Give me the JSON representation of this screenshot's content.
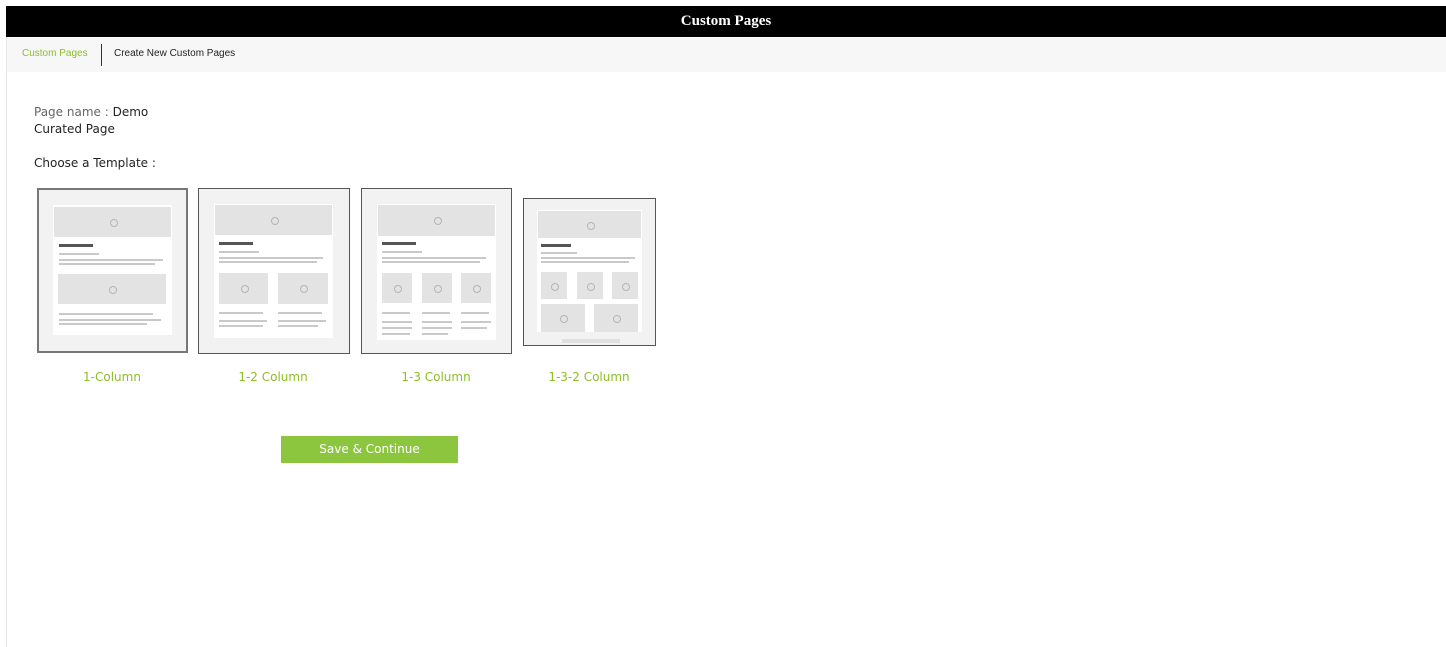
{
  "window": {
    "title": "Custom Pages"
  },
  "tabs": {
    "current": "Custom Pages",
    "create": "Create New Custom Pages"
  },
  "page": {
    "name_label": "Page name :",
    "name_value_line1": "Demo",
    "name_value_line2": "Curated Page",
    "choose_label": "Choose a Template :"
  },
  "templates": [
    {
      "label": "1-Column"
    },
    {
      "label": "1-2 Column"
    },
    {
      "label": "1-3 Column"
    },
    {
      "label": "1-3-2 Column"
    }
  ],
  "actions": {
    "save_label": "Save & Continue"
  },
  "colors": {
    "accent": "#8cbf26",
    "button": "#8cc63f",
    "titlebar": "#000000"
  }
}
